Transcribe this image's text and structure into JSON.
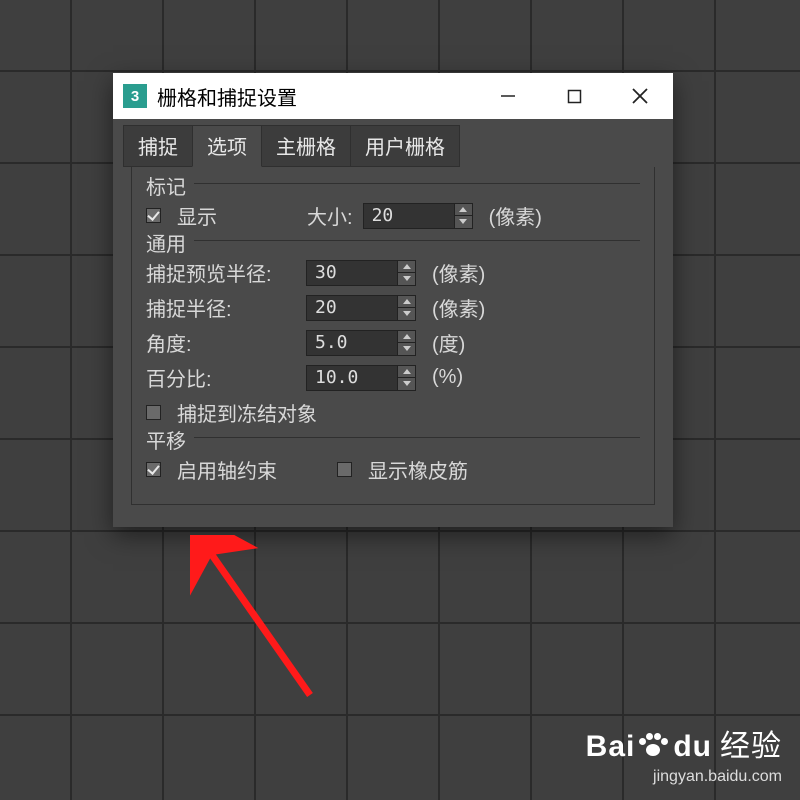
{
  "titlebar": {
    "app_icon_text": "3",
    "title": "栅格和捕捉设置"
  },
  "tabs": {
    "items": [
      {
        "label": "捕捉",
        "active": false
      },
      {
        "label": "选项",
        "active": true
      },
      {
        "label": "主栅格",
        "active": false
      },
      {
        "label": "用户栅格",
        "active": false
      }
    ]
  },
  "marker": {
    "title": "标记",
    "show_label": "显示",
    "show_checked": true,
    "size_label": "大小:",
    "size_value": "20",
    "size_unit": "(像素)"
  },
  "general": {
    "title": "通用",
    "preview_radius_label": "捕捉预览半径:",
    "preview_radius_value": "30",
    "preview_radius_unit": "(像素)",
    "snap_radius_label": "捕捉半径:",
    "snap_radius_value": "20",
    "snap_radius_unit": "(像素)",
    "angle_label": "角度:",
    "angle_value": "5.0",
    "angle_unit": "(度)",
    "percent_label": "百分比:",
    "percent_value": "10.0",
    "percent_unit": "(%)",
    "snap_frozen_label": "捕捉到冻结对象",
    "snap_frozen_checked": false
  },
  "translate": {
    "title": "平移",
    "axis_label": "启用轴约束",
    "axis_checked": true,
    "rubber_label": "显示橡皮筋",
    "rubber_checked": false
  },
  "watermark": {
    "main1": "Bai",
    "main2": "du",
    "tag": "经验",
    "sub": "jingyan.baidu.com"
  }
}
